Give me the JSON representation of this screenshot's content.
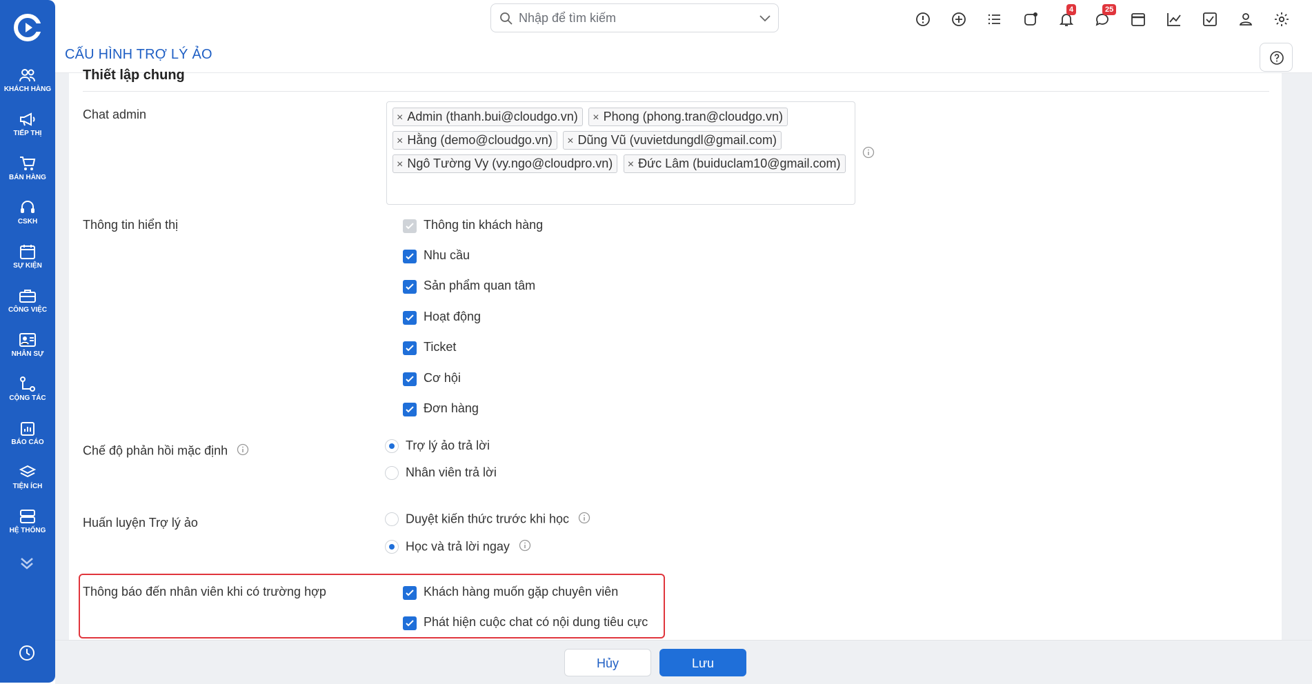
{
  "sidebar": {
    "logo": "cloudgo-logo",
    "items": [
      {
        "label": "KHÁCH HÀNG",
        "icon": "users-icon"
      },
      {
        "label": "TIẾP THỊ",
        "icon": "megaphone-icon"
      },
      {
        "label": "BÁN HÀNG",
        "icon": "cart-icon"
      },
      {
        "label": "CSKH",
        "icon": "headset-icon"
      },
      {
        "label": "SỰ KIỆN",
        "icon": "calendar-icon"
      },
      {
        "label": "CÔNG VIỆC",
        "icon": "briefcase-icon"
      },
      {
        "label": "NHÂN SỰ",
        "icon": "id-card-icon"
      },
      {
        "label": "CỘNG TÁC",
        "icon": "collab-icon"
      },
      {
        "label": "BÁO CÁO",
        "icon": "clipboard-icon"
      },
      {
        "label": "TIỆN ÍCH",
        "icon": "layers-icon"
      },
      {
        "label": "HỆ THỐNG",
        "icon": "server-icon"
      }
    ]
  },
  "topbar": {
    "search_placeholder": "Nhập để tìm kiếm",
    "notifications_count": "4",
    "messages_count": "25"
  },
  "header": {
    "title": "CẤU HÌNH TRỢ LÝ ẢO"
  },
  "section": {
    "title": "Thiết lập chung"
  },
  "chat_admin": {
    "label": "Chat admin",
    "tags": [
      "Admin (thanh.bui@cloudgo.vn)",
      "Phong (phong.tran@cloudgo.vn)",
      "Hằng (demo@cloudgo.vn)",
      "Dũng Vũ (vuvietdungdl@gmail.com)",
      "Ngô Tường Vy (vy.ngo@cloudpro.vn)",
      "Đức Lâm (buiduclam10@gmail.com)"
    ]
  },
  "display_info": {
    "label": "Thông tin hiển thị",
    "options": [
      {
        "label": "Thông tin khách hàng",
        "checked": true,
        "disabled": true
      },
      {
        "label": "Nhu cầu",
        "checked": true
      },
      {
        "label": "Sản phẩm quan tâm",
        "checked": true
      },
      {
        "label": "Hoạt động",
        "checked": true
      },
      {
        "label": "Ticket",
        "checked": true
      },
      {
        "label": "Cơ hội",
        "checked": true
      },
      {
        "label": "Đơn hàng",
        "checked": true
      }
    ]
  },
  "reply_mode": {
    "label": "Chế độ phản hồi mặc định",
    "options": [
      {
        "label": "Trợ lý ảo trả lời",
        "selected": true
      },
      {
        "label": "Nhân viên trả lời",
        "selected": false
      }
    ]
  },
  "training": {
    "label": "Huấn luyện Trợ lý ảo",
    "options": [
      {
        "label": "Duyệt kiến thức trước khi học",
        "selected": false
      },
      {
        "label": "Học và trả lời ngay",
        "selected": true
      }
    ]
  },
  "notify": {
    "label": "Thông báo đến nhân viên khi có trường hợp",
    "options": [
      {
        "label": "Khách hàng muốn gặp chuyên viên",
        "checked": true
      },
      {
        "label": "Phát hiện cuộc chat có nội dung tiêu cực",
        "checked": true
      }
    ]
  },
  "footer": {
    "cancel": "Hủy",
    "save": "Lưu"
  },
  "colors": {
    "brand": "#1f5fc4",
    "accent": "#1f6fd9",
    "highlight": "#e0353c"
  }
}
